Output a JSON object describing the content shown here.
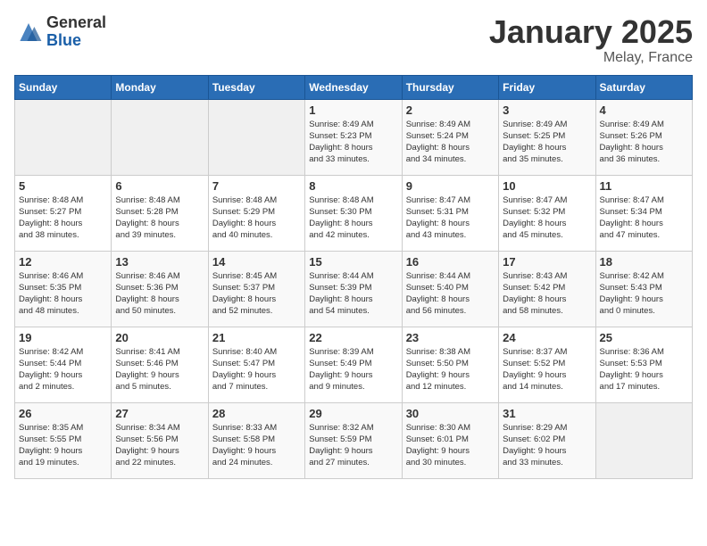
{
  "logo": {
    "general": "General",
    "blue": "Blue"
  },
  "title": "January 2025",
  "location": "Melay, France",
  "header_days": [
    "Sunday",
    "Monday",
    "Tuesday",
    "Wednesday",
    "Thursday",
    "Friday",
    "Saturday"
  ],
  "weeks": [
    [
      {
        "day": "",
        "info": ""
      },
      {
        "day": "",
        "info": ""
      },
      {
        "day": "",
        "info": ""
      },
      {
        "day": "1",
        "info": "Sunrise: 8:49 AM\nSunset: 5:23 PM\nDaylight: 8 hours\nand 33 minutes."
      },
      {
        "day": "2",
        "info": "Sunrise: 8:49 AM\nSunset: 5:24 PM\nDaylight: 8 hours\nand 34 minutes."
      },
      {
        "day": "3",
        "info": "Sunrise: 8:49 AM\nSunset: 5:25 PM\nDaylight: 8 hours\nand 35 minutes."
      },
      {
        "day": "4",
        "info": "Sunrise: 8:49 AM\nSunset: 5:26 PM\nDaylight: 8 hours\nand 36 minutes."
      }
    ],
    [
      {
        "day": "5",
        "info": "Sunrise: 8:48 AM\nSunset: 5:27 PM\nDaylight: 8 hours\nand 38 minutes."
      },
      {
        "day": "6",
        "info": "Sunrise: 8:48 AM\nSunset: 5:28 PM\nDaylight: 8 hours\nand 39 minutes."
      },
      {
        "day": "7",
        "info": "Sunrise: 8:48 AM\nSunset: 5:29 PM\nDaylight: 8 hours\nand 40 minutes."
      },
      {
        "day": "8",
        "info": "Sunrise: 8:48 AM\nSunset: 5:30 PM\nDaylight: 8 hours\nand 42 minutes."
      },
      {
        "day": "9",
        "info": "Sunrise: 8:47 AM\nSunset: 5:31 PM\nDaylight: 8 hours\nand 43 minutes."
      },
      {
        "day": "10",
        "info": "Sunrise: 8:47 AM\nSunset: 5:32 PM\nDaylight: 8 hours\nand 45 minutes."
      },
      {
        "day": "11",
        "info": "Sunrise: 8:47 AM\nSunset: 5:34 PM\nDaylight: 8 hours\nand 47 minutes."
      }
    ],
    [
      {
        "day": "12",
        "info": "Sunrise: 8:46 AM\nSunset: 5:35 PM\nDaylight: 8 hours\nand 48 minutes."
      },
      {
        "day": "13",
        "info": "Sunrise: 8:46 AM\nSunset: 5:36 PM\nDaylight: 8 hours\nand 50 minutes."
      },
      {
        "day": "14",
        "info": "Sunrise: 8:45 AM\nSunset: 5:37 PM\nDaylight: 8 hours\nand 52 minutes."
      },
      {
        "day": "15",
        "info": "Sunrise: 8:44 AM\nSunset: 5:39 PM\nDaylight: 8 hours\nand 54 minutes."
      },
      {
        "day": "16",
        "info": "Sunrise: 8:44 AM\nSunset: 5:40 PM\nDaylight: 8 hours\nand 56 minutes."
      },
      {
        "day": "17",
        "info": "Sunrise: 8:43 AM\nSunset: 5:42 PM\nDaylight: 8 hours\nand 58 minutes."
      },
      {
        "day": "18",
        "info": "Sunrise: 8:42 AM\nSunset: 5:43 PM\nDaylight: 9 hours\nand 0 minutes."
      }
    ],
    [
      {
        "day": "19",
        "info": "Sunrise: 8:42 AM\nSunset: 5:44 PM\nDaylight: 9 hours\nand 2 minutes."
      },
      {
        "day": "20",
        "info": "Sunrise: 8:41 AM\nSunset: 5:46 PM\nDaylight: 9 hours\nand 5 minutes."
      },
      {
        "day": "21",
        "info": "Sunrise: 8:40 AM\nSunset: 5:47 PM\nDaylight: 9 hours\nand 7 minutes."
      },
      {
        "day": "22",
        "info": "Sunrise: 8:39 AM\nSunset: 5:49 PM\nDaylight: 9 hours\nand 9 minutes."
      },
      {
        "day": "23",
        "info": "Sunrise: 8:38 AM\nSunset: 5:50 PM\nDaylight: 9 hours\nand 12 minutes."
      },
      {
        "day": "24",
        "info": "Sunrise: 8:37 AM\nSunset: 5:52 PM\nDaylight: 9 hours\nand 14 minutes."
      },
      {
        "day": "25",
        "info": "Sunrise: 8:36 AM\nSunset: 5:53 PM\nDaylight: 9 hours\nand 17 minutes."
      }
    ],
    [
      {
        "day": "26",
        "info": "Sunrise: 8:35 AM\nSunset: 5:55 PM\nDaylight: 9 hours\nand 19 minutes."
      },
      {
        "day": "27",
        "info": "Sunrise: 8:34 AM\nSunset: 5:56 PM\nDaylight: 9 hours\nand 22 minutes."
      },
      {
        "day": "28",
        "info": "Sunrise: 8:33 AM\nSunset: 5:58 PM\nDaylight: 9 hours\nand 24 minutes."
      },
      {
        "day": "29",
        "info": "Sunrise: 8:32 AM\nSunset: 5:59 PM\nDaylight: 9 hours\nand 27 minutes."
      },
      {
        "day": "30",
        "info": "Sunrise: 8:30 AM\nSunset: 6:01 PM\nDaylight: 9 hours\nand 30 minutes."
      },
      {
        "day": "31",
        "info": "Sunrise: 8:29 AM\nSunset: 6:02 PM\nDaylight: 9 hours\nand 33 minutes."
      },
      {
        "day": "",
        "info": ""
      }
    ]
  ]
}
